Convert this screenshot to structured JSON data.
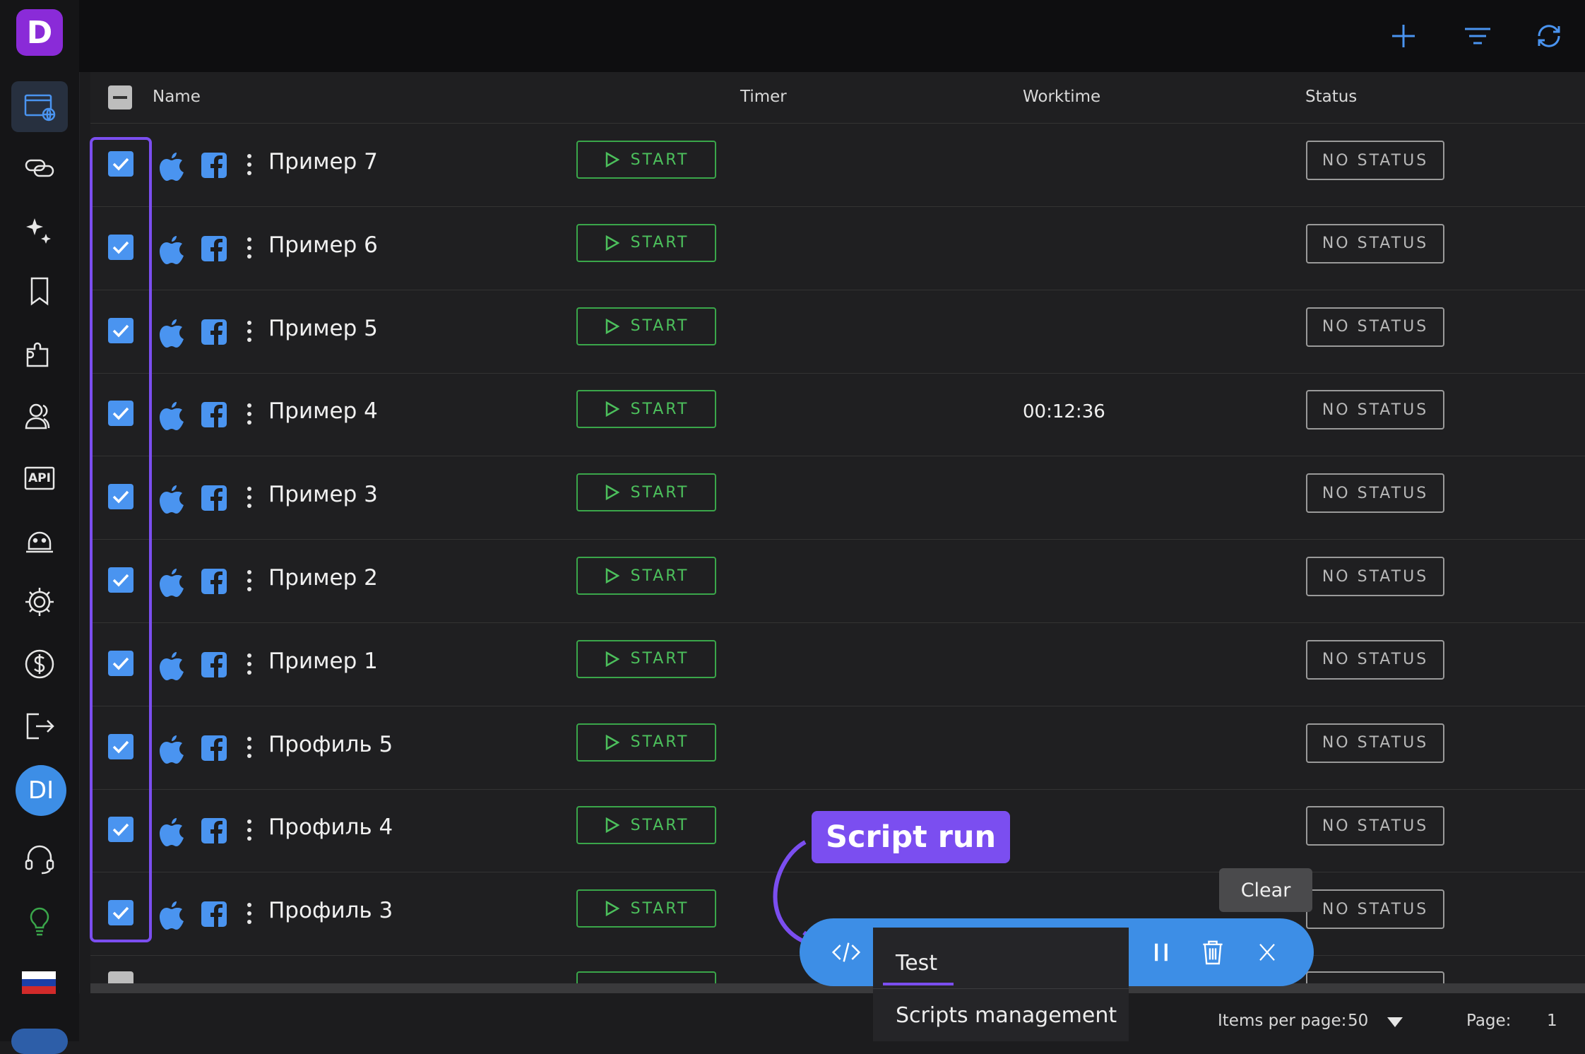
{
  "app": {
    "logo_letter": "D",
    "avatar_initials": "DI"
  },
  "sidebar": {
    "items": [
      {
        "name": "browser-profiles-icon",
        "active": true
      },
      {
        "name": "proxies-icon"
      },
      {
        "name": "sparkles-icon"
      },
      {
        "name": "bookmark-icon"
      },
      {
        "name": "extensions-icon"
      },
      {
        "name": "team-icon"
      },
      {
        "name": "api-icon",
        "label": "API"
      },
      {
        "name": "robot-icon"
      },
      {
        "name": "gear-icon"
      },
      {
        "name": "dollar-icon"
      },
      {
        "name": "logout-icon"
      }
    ],
    "flag_colors": [
      "#ffffff",
      "#1c3fa8",
      "#d12a2a"
    ]
  },
  "toolbar": {
    "icons": [
      "plus-icon",
      "filter-icon",
      "refresh-icon"
    ],
    "accent": "#4a94f0"
  },
  "table": {
    "columns": {
      "name": "Name",
      "timer": "Timer",
      "worktime": "Worktime",
      "status": "Status"
    },
    "start_label": "START",
    "status_label": "NO STATUS",
    "rows": [
      {
        "name": "Пример 7",
        "worktime": ""
      },
      {
        "name": "Пример 6",
        "worktime": ""
      },
      {
        "name": "Пример 5",
        "worktime": ""
      },
      {
        "name": "Пример 4",
        "worktime": "00:12:36"
      },
      {
        "name": "Пример 3",
        "worktime": ""
      },
      {
        "name": "Пример 2",
        "worktime": ""
      },
      {
        "name": "Пример 1",
        "worktime": ""
      },
      {
        "name": "Профиль 5",
        "worktime": ""
      },
      {
        "name": "Профиль 4",
        "worktime": ""
      },
      {
        "name": "Профиль 3",
        "worktime": ""
      }
    ]
  },
  "footer": {
    "items_per_page_label": "Items per page:",
    "items_per_page_value": "50",
    "page_label": "Page:",
    "page_value": "1"
  },
  "annotation": {
    "callout": "Script run",
    "color": "#7b4ef0"
  },
  "script_bar": {
    "tooltip": "Clear",
    "menu": [
      "Test",
      "Scripts management"
    ],
    "color": "#3d8ee6"
  }
}
